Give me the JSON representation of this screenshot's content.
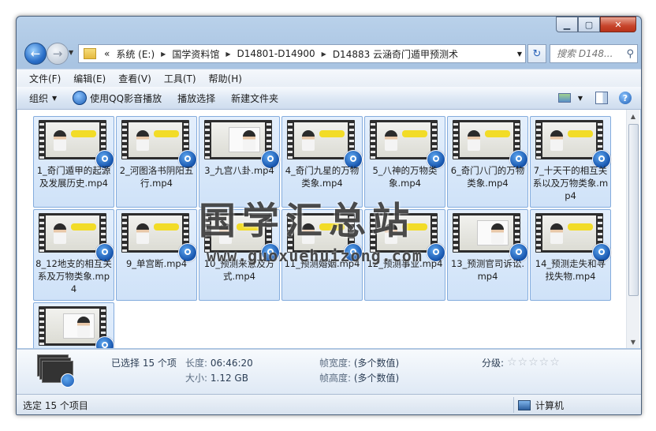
{
  "window": {
    "caption": {
      "minimize": "▁",
      "maximize": "▢",
      "close": "✕"
    }
  },
  "nav": {
    "breadcrumb": [
      "«",
      "系统 (E:)",
      "国学资料馆",
      "D14801-D14900",
      "D14883 云涵奇门遁甲预测术"
    ],
    "search_placeholder": "搜索 D148..."
  },
  "menu": [
    "文件(F)",
    "编辑(E)",
    "查看(V)",
    "工具(T)",
    "帮助(H)"
  ],
  "commands": {
    "organize": "组织",
    "play_qq": "使用QQ影音播放",
    "play_selection": "播放选择",
    "new_folder": "新建文件夹"
  },
  "files": [
    {
      "name": "1_奇门遁甲的起源及发展历史.mp4",
      "thumb": "teacher"
    },
    {
      "name": "2_河图洛书阴阳五行.mp4",
      "thumb": "teacher"
    },
    {
      "name": "3_九宫八卦.mp4",
      "thumb": "board"
    },
    {
      "name": "4_奇门九星的万物类象.mp4",
      "thumb": "teacher"
    },
    {
      "name": "5_八神的万物类象.mp4",
      "thumb": "teacher"
    },
    {
      "name": "6_奇门八门的万物类象.mp4",
      "thumb": "teacher"
    },
    {
      "name": "7_十天干的相互关系以及万物类象.mp4",
      "thumb": "teacher"
    },
    {
      "name": "8_12地支的相互关系及万物类象.mp4",
      "thumb": "teacher"
    },
    {
      "name": "9_单宫断.mp4",
      "thumb": "teacher"
    },
    {
      "name": "10_预测来意及方式.mp4",
      "thumb": "teacher"
    },
    {
      "name": "11_预测婚姻.mp4",
      "thumb": "teacher"
    },
    {
      "name": "12_预测事业.mp4",
      "thumb": "teacher"
    },
    {
      "name": "13_预测官司诉讼.mp4",
      "thumb": "board"
    },
    {
      "name": "14_预测走失和寻找失物.mp4",
      "thumb": "teacher"
    },
    {
      "name": "",
      "thumb": "board"
    }
  ],
  "watermark": {
    "title": "国学汇总站",
    "url": "www.guoxuehuizong.com"
  },
  "details": {
    "selected": "已选择 15 个项",
    "length_label": "长度:",
    "length_value": "06:46:20",
    "size_label": "大小:",
    "size_value": "1.12 GB",
    "width_label": "帧宽度:",
    "width_value": "(多个数值)",
    "height_label": "帧高度:",
    "height_value": "(多个数值)",
    "rating_label": "分级:",
    "rating_stars": "☆☆☆☆☆"
  },
  "status": {
    "left": "选定 15 个项目",
    "right": "计算机"
  }
}
